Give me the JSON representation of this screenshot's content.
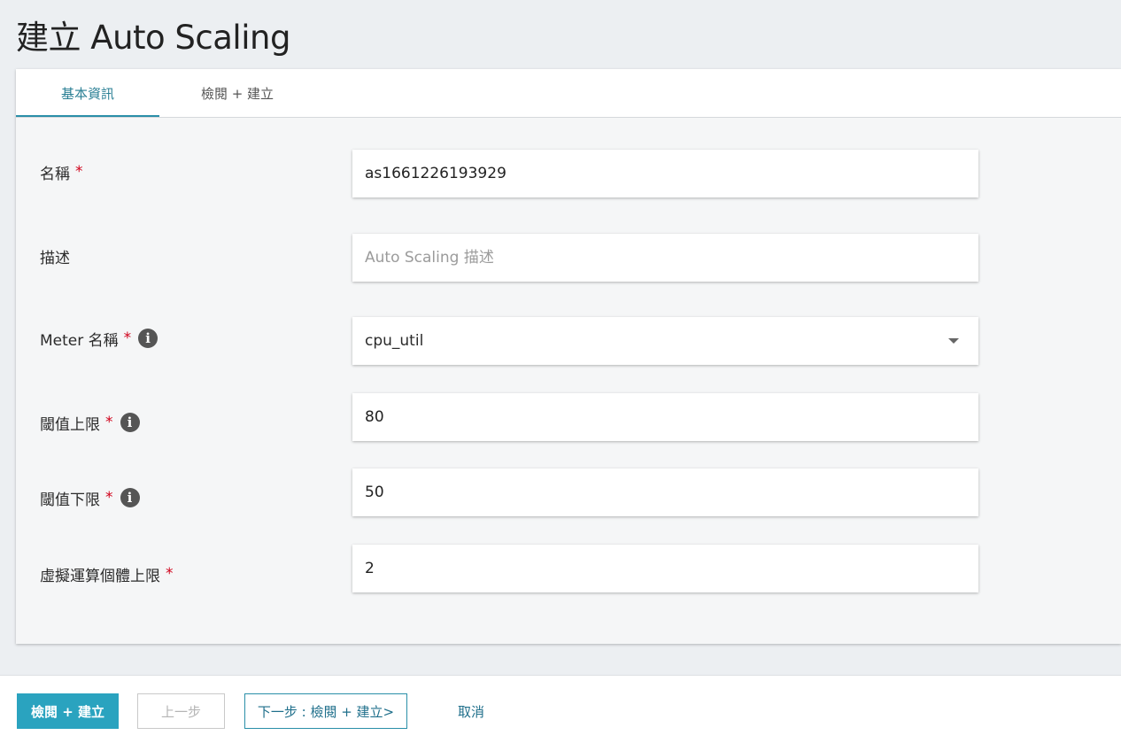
{
  "page": {
    "title": "建立 Auto Scaling"
  },
  "tabs": [
    {
      "label": "基本資訊",
      "active": true
    },
    {
      "label": "檢閱 + 建立",
      "active": false
    }
  ],
  "form": {
    "name": {
      "label": "名稱",
      "required": true,
      "value": "as1661226193929"
    },
    "description": {
      "label": "描述",
      "required": false,
      "value": "",
      "placeholder": "Auto Scaling 描述"
    },
    "meter": {
      "label": "Meter 名稱",
      "required": true,
      "info": true,
      "value": "cpu_util",
      "icon": "chevron-down-icon"
    },
    "upper_threshold": {
      "label": "閾值上限",
      "required": true,
      "info": true,
      "value": "80"
    },
    "lower_threshold": {
      "label": "閾值下限",
      "required": true,
      "info": true,
      "value": "50"
    },
    "max_instances": {
      "label": "虛擬運算個體上限",
      "required": true,
      "value": "2"
    }
  },
  "required_mark": "*",
  "info_glyph": "i",
  "footer": {
    "review_create": "檢閱 + 建立",
    "previous": "上一步",
    "next": "下一步 : 檢閱 + 建立>",
    "cancel": "取消"
  },
  "colors": {
    "accent": "#2aa3bf",
    "tab_active": "#2a7f94",
    "required": "#d0021b",
    "background": "#eceff2"
  }
}
